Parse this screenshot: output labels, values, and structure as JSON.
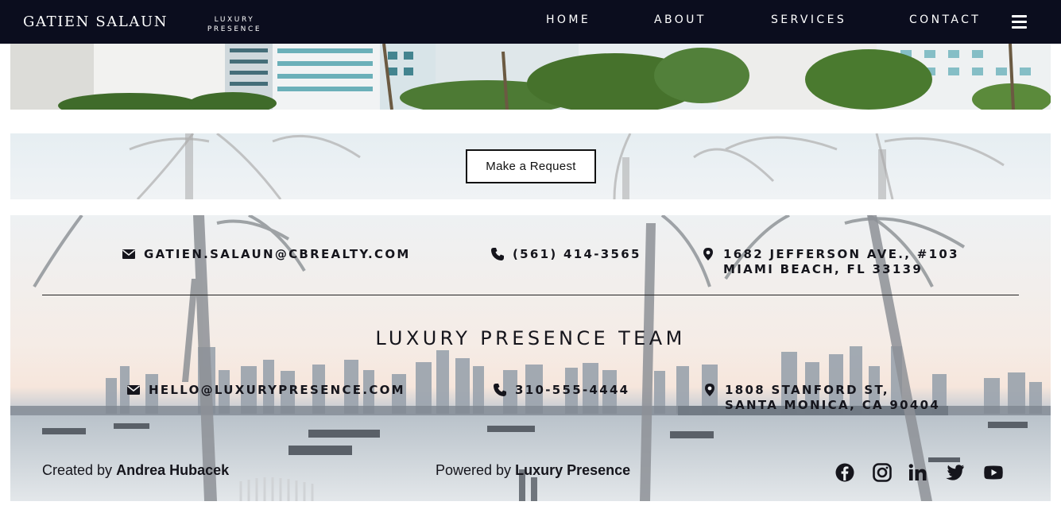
{
  "header": {
    "brand": "GATIEN SALAUN",
    "sublogo_line1": "LUXURY",
    "sublogo_line2": "PRESENCE",
    "nav": [
      "HOME",
      "ABOUT",
      "SERVICES",
      "CONTACT"
    ],
    "menu_icon": "hamburger-menu-icon"
  },
  "request": {
    "button_label": "Make a Request"
  },
  "agent_contact": {
    "email": "GATIEN.SALAUN@CBREALTY.COM",
    "phone": "(561) 414-3565",
    "address_line1": "1682 JEFFERSON AVE., #103",
    "address_line2": "MIAMI BEACH, FL 33139"
  },
  "team": {
    "title": "LUXURY PRESENCE TEAM",
    "email": "HELLO@LUXURYPRESENCE.COM",
    "phone": "310-555-4444",
    "address_line1": "1808 STANFORD ST,",
    "address_line2": "SANTA MONICA, CA 90404"
  },
  "credits": {
    "created_prefix": "Created by",
    "created_name": "Andrea Hubacek",
    "powered_prefix": "Powered by",
    "powered_name": "Luxury Presence"
  },
  "social_icons": [
    "facebook-icon",
    "instagram-icon",
    "linkedin-icon",
    "twitter-icon",
    "youtube-icon"
  ],
  "colors": {
    "header_bg": "#0b0d1e",
    "text_dark": "#15151c",
    "button_border": "#111111"
  }
}
